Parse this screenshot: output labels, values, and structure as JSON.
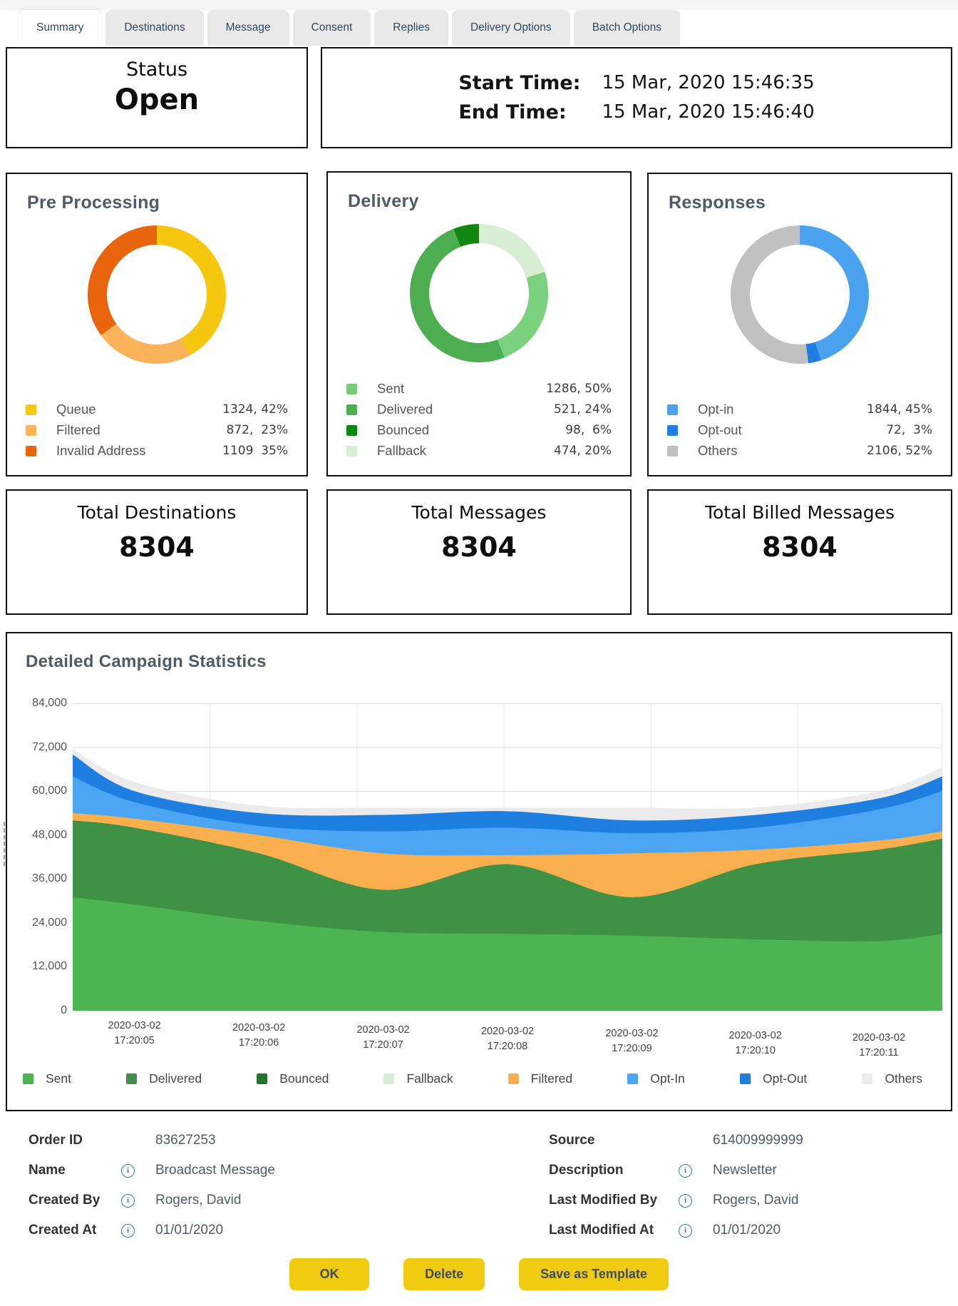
{
  "tabs": [
    {
      "label": "Summary",
      "active": true
    },
    {
      "label": "Destinations",
      "active": false
    },
    {
      "label": "Message",
      "active": false
    },
    {
      "label": "Consent",
      "active": false
    },
    {
      "label": "Replies",
      "active": false
    },
    {
      "label": "Delivery Options",
      "active": false
    },
    {
      "label": "Batch Options",
      "active": false
    }
  ],
  "status_panel": {
    "label": "Status",
    "value": "Open"
  },
  "time_panel": {
    "rows": [
      {
        "label": "Start Time:",
        "value": "15 Mar, 2020 15:46:35"
      },
      {
        "label": "End Time:",
        "value": "15 Mar, 2020 15:46:40"
      }
    ]
  },
  "totals": [
    {
      "label": "Total Destinations",
      "value": "8304"
    },
    {
      "label": "Total Messages",
      "value": "8304"
    },
    {
      "label": "Total Billed Messages",
      "value": "8304"
    }
  ],
  "details": {
    "left": [
      {
        "label": "Order ID",
        "info": false,
        "value": "83627253"
      },
      {
        "label": "Name",
        "info": true,
        "value": "Broadcast Message"
      },
      {
        "label": "Created By",
        "info": true,
        "value": "Rogers, David"
      },
      {
        "label": "Created At",
        "info": true,
        "value": "01/01/2020"
      }
    ],
    "right": [
      {
        "label": "Source",
        "info": false,
        "value": "614009999999"
      },
      {
        "label": "Description",
        "info": true,
        "value": "Newsletter"
      },
      {
        "label": "Last Modified By",
        "info": true,
        "value": "Rogers, David"
      },
      {
        "label": "Last Modified At",
        "info": true,
        "value": "01/01/2020"
      }
    ]
  },
  "buttons": [
    {
      "label": "OK"
    },
    {
      "label": "Delete"
    },
    {
      "label": "Save as Template"
    }
  ],
  "chart_data": [
    {
      "type": "pie",
      "donut": true,
      "title": "Pre Processing",
      "legend": [
        {
          "label": "Queue",
          "value": 1324,
          "pct": 42,
          "color": "#F5C70E",
          "value_text": "1324, 42%"
        },
        {
          "label": "Filtered",
          "value": 872,
          "pct": 23,
          "color": "#FBB35A",
          "value_text": "872,  23%"
        },
        {
          "label": "Invalid Address",
          "value": 1109,
          "pct": 35,
          "color": "#E8650D",
          "value_text": "1109  35%"
        }
      ],
      "draw": [
        {
          "color": "#F5C70E",
          "pct": 42
        },
        {
          "color": "#FBB35A",
          "pct": 23
        },
        {
          "color": "#E8650D",
          "pct": 35
        }
      ]
    },
    {
      "type": "pie",
      "donut": true,
      "title": "Delivery",
      "legend": [
        {
          "label": "Sent",
          "value": 1286,
          "pct": 50,
          "color": "#77CC7A",
          "value_text": "1286, 50%"
        },
        {
          "label": "Delivered",
          "value": 521,
          "pct": 24,
          "color": "#4CAE51",
          "value_text": "521, 24%"
        },
        {
          "label": "Bounced",
          "value": 98,
          "pct": 6,
          "color": "#0F870F",
          "value_text": "98,  6%"
        },
        {
          "label": "Fallback",
          "value": 474,
          "pct": 20,
          "color": "#D8EED4",
          "value_text": "474, 20%"
        }
      ],
      "draw": [
        {
          "color": "#D8EED4",
          "pct": 20
        },
        {
          "color": "#7BD17E",
          "pct": 24
        },
        {
          "color": "#4CAE51",
          "pct": 50
        },
        {
          "color": "#0F870F",
          "pct": 6
        }
      ]
    },
    {
      "type": "pie",
      "donut": true,
      "title": "Responses",
      "legend": [
        {
          "label": "Opt-in",
          "value": 1844,
          "pct": 45,
          "color": "#4BA3F0",
          "value_text": "1844, 45%"
        },
        {
          "label": "Opt-out",
          "value": 72,
          "pct": 3,
          "color": "#1E7FE0",
          "value_text": "72,  3%"
        },
        {
          "label": "Others",
          "value": 2106,
          "pct": 52,
          "color": "#C1C1C1",
          "value_text": "2106, 52%"
        }
      ],
      "draw": [
        {
          "color": "#4BA3F0",
          "pct": 45
        },
        {
          "color": "#1E7FE0",
          "pct": 3
        },
        {
          "color": "#C1C1C1",
          "pct": 52
        }
      ]
    },
    {
      "type": "area",
      "stacked": true,
      "title": "Detailed Campaign Statistics",
      "ylim": [
        0,
        84000
      ],
      "y_ticks": [
        "84,000",
        "72,000",
        "60,000",
        "48,000",
        "36,000",
        "24,000",
        "12,000",
        "0"
      ],
      "grid": true,
      "legend_position": "bottom",
      "x_tick_labels": [
        [
          "2020-03-02",
          "17:20:05"
        ],
        [
          "2020-03-02",
          "17:20:06"
        ],
        [
          "2020-03-02",
          "17:20:07"
        ],
        [
          "2020-03-02",
          "17:20:08"
        ],
        [
          "2020-03-02",
          "17:20:09"
        ],
        [
          "2020-03-02",
          "17:20:10"
        ],
        [
          "2020-03-02",
          "17:20:11"
        ]
      ],
      "x_tick_fractions": [
        0.071,
        0.214,
        0.357,
        0.5,
        0.643,
        0.785,
        0.927
      ],
      "vgrid_fractions": [
        0.158,
        0.327,
        0.496,
        0.665,
        0.834,
        1
      ],
      "sample_fractions": [
        0,
        0.071,
        0.214,
        0.357,
        0.5,
        0.643,
        0.785,
        0.927,
        1
      ],
      "series": [
        {
          "name": "Sent",
          "color": "#4CB551",
          "values": [
            31000,
            29000,
            24500,
            21500,
            21000,
            20500,
            19500,
            19000,
            21000
          ]
        },
        {
          "name": "Delivered",
          "color": "#3E9145",
          "values": [
            21000,
            21000,
            18500,
            11500,
            19000,
            10500,
            20500,
            25000,
            26000
          ]
        },
        {
          "name": "Bounced",
          "color": "#27742D",
          "values": [
            0,
            0,
            0,
            0,
            0,
            0,
            0,
            0,
            0
          ]
        },
        {
          "name": "Fallback",
          "color": "#D8EFD6",
          "values": [
            0,
            0,
            0,
            0,
            0,
            0,
            0,
            0,
            0
          ]
        },
        {
          "name": "Filtered",
          "color": "#F9AF4D",
          "values": [
            2000,
            2500,
            5000,
            10000,
            2500,
            12000,
            4000,
            2500,
            2000
          ]
        },
        {
          "name": "Opt-In",
          "color": "#4BA5F2",
          "values": [
            10000,
            4500,
            2500,
            6000,
            7500,
            5500,
            6000,
            8500,
            11000
          ]
        },
        {
          "name": "Opt-Out",
          "color": "#1E7FE0",
          "values": [
            6000,
            3000,
            3500,
            4500,
            4500,
            3500,
            3500,
            3000,
            4000
          ]
        },
        {
          "name": "Others",
          "color": "#EBEBEB",
          "values": [
            1500,
            2500,
            2000,
            2000,
            1000,
            3500,
            2000,
            2000,
            2500
          ]
        }
      ]
    }
  ]
}
